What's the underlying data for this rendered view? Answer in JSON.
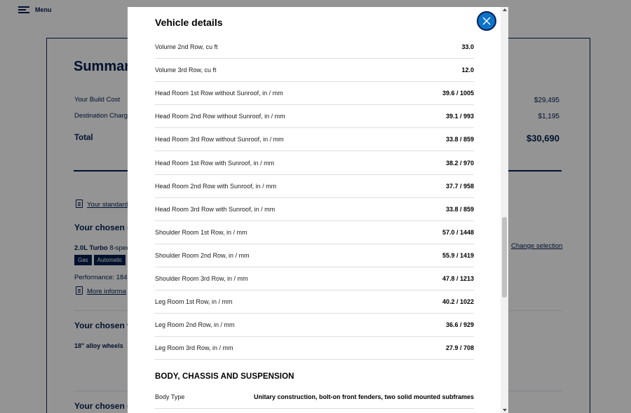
{
  "page": {
    "menu_label": "Menu",
    "summary_title": "Summary",
    "build_cost_label": "Your Build Cost",
    "build_cost_value": "$29,495",
    "destination_label": "Destination Charge",
    "destination_value": "$1,195",
    "total_label": "Total",
    "total_value": "$30,690",
    "standard_link": "Your standard",
    "chosen_engine": "Your chosen e",
    "engine_name": "2.0L Turbo",
    "engine_desc": "8-spee",
    "tags": [
      "Gas",
      "Automatic"
    ],
    "performance": "Performance: 184",
    "more_info": "More informa",
    "change_selection": "Change selection",
    "chosen_wheels": "Your chosen w",
    "wheels": "18\" alloy wheels",
    "chosen_other": "Your chosen e"
  },
  "modal": {
    "title": "Vehicle details",
    "close_label": "Close",
    "specs": [
      {
        "label": "Volume 2nd Row, cu ft",
        "value": "33.0"
      },
      {
        "label": "Volume 3rd Row, cu ft",
        "value": "12.0"
      },
      {
        "label": "Head Room 1st Row without Sunroof, in / mm",
        "value": "39.6 / 1005"
      },
      {
        "label": "Head Room 2nd Row without Sunroof, in / mm",
        "value": "39.1 / 993"
      },
      {
        "label": "Head Room 3rd Row without Sunroof, in / mm",
        "value": "33.8 / 859"
      },
      {
        "label": "Head Room 1st Row with Sunroof, in / mm",
        "value": "38.2 / 970"
      },
      {
        "label": "Head Room 2nd Row with Sunroof, in / mm",
        "value": "37.7 / 958"
      },
      {
        "label": "Head Room 3rd Row with Sunroof, in / mm",
        "value": "33.8 / 859"
      },
      {
        "label": "Shoulder Room 1st Row, in / mm",
        "value": "57.0 / 1448"
      },
      {
        "label": "Shoulder Room 2nd Row, in / mm",
        "value": "55.9 / 1419"
      },
      {
        "label": "Shoulder Room 3rd Row, in / mm",
        "value": "47.8 / 1213"
      },
      {
        "label": "Leg Room 1st Row, in / mm",
        "value": "40.2 / 1022"
      },
      {
        "label": "Leg Room 2nd Row, in / mm",
        "value": "36.6 / 929"
      },
      {
        "label": "Leg Room 3rd Row, in / mm",
        "value": "27.9 / 708"
      }
    ],
    "section_title": "BODY, CHASSIS AND SUSPENSION",
    "body_type_label": "Body Type",
    "body_type_value": "Unitary construction, bolt-on front fenders, two solid mounted subframes"
  },
  "colors": {
    "brand_navy": "#001e50",
    "close_blue": "#0c73c8"
  }
}
